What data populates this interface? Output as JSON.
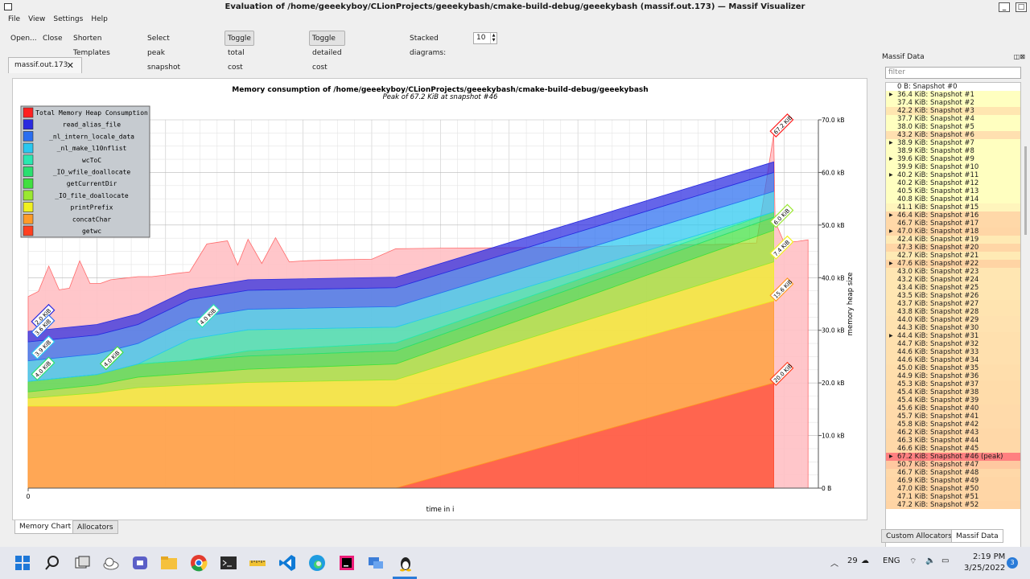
{
  "window": {
    "title": "Evaluation of /home/geeekyboy/CLionProjects/geeekybash/cmake-build-debug/geeekybash (massif.out.173) — Massif Visualizer",
    "minimize": "_",
    "close": "□"
  },
  "menu": [
    "File",
    "View",
    "Settings",
    "Help"
  ],
  "toolbar": {
    "open": "Open...",
    "close": "Close",
    "shorten": "Shorten Templates",
    "select_peak": "Select peak snapshot",
    "toggle_total": "Toggle total cost graph",
    "toggle_detailed": "Toggle detailed cost graph",
    "stacked_label": "Stacked diagrams:",
    "stacked_value": "10"
  },
  "doc_tab": {
    "label": "massif.out.173",
    "close": "✕"
  },
  "chart_data": {
    "type": "area",
    "title": "Memory consumption of /home/geeekyboy/CLionProjects/geeekybash/cmake-build-debug/geeekybash",
    "subtitle": "Peak of 67.2 KiB at snapshot #46",
    "xlabel": "time in i",
    "ylabel": "memory heap size",
    "xlim": [
      0,
      11500000000
    ],
    "ylim": [
      0,
      70
    ],
    "x_ticks": [
      "0",
      "1e+09",
      "2e+09",
      "3e+09",
      "4e+09",
      "5e+09",
      "6e+09",
      "7e+09",
      "8e+09",
      "9e+09",
      "1e+10",
      "1.1e+10"
    ],
    "y_ticks": [
      "0 B",
      "10.0 kB",
      "20.0 kB",
      "30.0 kB",
      "40.0 kB",
      "50.0 kB",
      "60.0 kB",
      "70.0 kB"
    ],
    "legend_position": "top-left",
    "series_order": [
      "getwc",
      "concatChar",
      "printPrefix",
      "_IO_file_doallocate",
      "getCurrentDir",
      "_IO_wfile_doallocate",
      "wcToC",
      "_nl_make_l10nflist",
      "_nl_intern_locale_data",
      "read_alias_file"
    ],
    "series": [
      {
        "name": "Total Memory Heap Consumption",
        "color": "#ff2020",
        "x": [
          0,
          0.15,
          0.3,
          0.45,
          0.6,
          0.75,
          0.9,
          1.05,
          1.2,
          1.4,
          1.6,
          1.8,
          2.0,
          2.15,
          2.35,
          2.6,
          2.75,
          2.9,
          3.05,
          3.2,
          3.4,
          3.6,
          3.8,
          4.0,
          4.5,
          5.0,
          5.35,
          6.0,
          7.0,
          8.0,
          9.0,
          10.0,
          10.6,
          10.85,
          10.87,
          11.0,
          11.2,
          11.35
        ],
        "y": [
          36.4,
          37.4,
          42.2,
          37.7,
          38.0,
          43.2,
          38.9,
          38.9,
          39.6,
          39.9,
          40.2,
          40.2,
          40.5,
          40.8,
          41.1,
          46.4,
          46.7,
          47.0,
          42.4,
          47.3,
          42.7,
          47.6,
          43.0,
          43.2,
          43.4,
          43.5,
          45.5,
          45.6,
          45.7,
          45.8,
          46.2,
          46.3,
          46.6,
          67.2,
          50.7,
          46.7,
          46.9,
          47.2
        ]
      },
      {
        "name": "read_alias_file",
        "color": "#2a2ae0"
      },
      {
        "name": "_nl_intern_locale_data",
        "color": "#2a6ef0"
      },
      {
        "name": "_nl_make_l10nflist",
        "color": "#2ac8f0"
      },
      {
        "name": "wcToC",
        "color": "#2ae8b0"
      },
      {
        "name": "_IO_wfile_doallocate",
        "color": "#2ae070"
      },
      {
        "name": "getCurrentDir",
        "color": "#40e040"
      },
      {
        "name": "_IO_file_doallocate",
        "color": "#9ae830"
      },
      {
        "name": "printPrefix",
        "color": "#f0f020"
      },
      {
        "name": "concatChar",
        "color": "#ff9b28"
      },
      {
        "name": "getwc",
        "color": "#ff4020"
      }
    ],
    "stack_x": [
      0,
      1.0,
      1.6,
      2.35,
      3.2,
      5.35,
      10.85
    ],
    "stack_values": {
      "getwc": [
        0,
        0,
        0,
        0,
        0,
        0,
        20.0
      ],
      "concatChar": [
        15.6,
        15.6,
        15.6,
        15.6,
        15.6,
        15.6,
        15.6
      ],
      "printPrefix": [
        1.5,
        2.5,
        3.5,
        4.0,
        4.5,
        5.0,
        7.4
      ],
      "_IO_file_doallocate": [
        1.2,
        1.5,
        2.0,
        2.2,
        2.5,
        3.0,
        6.0
      ],
      "getCurrentDir": [
        2.0,
        2.0,
        2.5,
        2.5,
        2.5,
        2.5,
        2.5
      ],
      "_IO_wfile_doallocate": [
        0,
        0,
        0,
        0,
        1.0,
        1.5,
        1.0
      ],
      "wcToC": [
        0,
        0,
        0,
        4.0,
        4.0,
        3.0,
        0
      ],
      "_nl_make_l10nflist": [
        3.9,
        3.9,
        3.9,
        3.9,
        3.9,
        3.9,
        3.9
      ],
      "_nl_intern_locale_data": [
        3.6,
        3.6,
        3.6,
        3.6,
        3.6,
        3.6,
        3.6
      ],
      "read_alias_file": [
        2.0,
        2.0,
        2.0,
        2.0,
        2.0,
        2.0,
        2.0
      ]
    },
    "annotations": [
      {
        "text": "67.2 KiB",
        "x": 10.85,
        "y": 67.2,
        "color": "#ff2020"
      },
      {
        "text": "6.0 KiB",
        "x": 10.85,
        "y": 50.0,
        "color": "#9ae830"
      },
      {
        "text": "7.4 KiB",
        "x": 10.85,
        "y": 44.0,
        "color": "#f0f020"
      },
      {
        "text": "15.6 KiB",
        "x": 10.85,
        "y": 36.0,
        "color": "#ff9b28"
      },
      {
        "text": "20.0 KiB",
        "x": 10.85,
        "y": 20.0,
        "color": "#ff4020"
      },
      {
        "text": "2.0 KiB",
        "x": 0.1,
        "y": 31.0,
        "color": "#2a2ae0"
      },
      {
        "text": "3.6 KiB",
        "x": 0.1,
        "y": 29.0,
        "color": "#2a6ef0"
      },
      {
        "text": "3.9 KiB",
        "x": 0.1,
        "y": 25.0,
        "color": "#2ac8f0"
      },
      {
        "text": "4.0 KiB",
        "x": 0.1,
        "y": 21.0,
        "color": "#2ae070"
      },
      {
        "text": "4.0 KiB",
        "x": 1.1,
        "y": 23.0,
        "color": "#40e040"
      },
      {
        "text": "4.0 KiB",
        "x": 2.5,
        "y": 31.0,
        "color": "#2ae8b0"
      }
    ]
  },
  "bottom_tabs": [
    "Memory Chart",
    "Allocators"
  ],
  "massif_panel": {
    "title": "Massif Data",
    "filter_placeholder": "filter",
    "snapshots": [
      {
        "label": "0 B: Snapshot #0",
        "expandable": false,
        "color": "#ffffff"
      },
      {
        "label": "36.4 KiB: Snapshot #1",
        "expandable": true,
        "color": "#ffffc0"
      },
      {
        "label": "37.4 KiB: Snapshot #2",
        "expandable": false,
        "color": "#ffffc0"
      },
      {
        "label": "42.2 KiB: Snapshot #3",
        "expandable": false,
        "color": "#ffe6b0"
      },
      {
        "label": "37.7 KiB: Snapshot #4",
        "expandable": false,
        "color": "#ffffc0"
      },
      {
        "label": "38.0 KiB: Snapshot #5",
        "expandable": false,
        "color": "#ffffc0"
      },
      {
        "label": "43.2 KiB: Snapshot #6",
        "expandable": false,
        "color": "#ffe0b0"
      },
      {
        "label": "38.9 KiB: Snapshot #7",
        "expandable": true,
        "color": "#ffffc0"
      },
      {
        "label": "38.9 KiB: Snapshot #8",
        "expandable": false,
        "color": "#ffffc0"
      },
      {
        "label": "39.6 KiB: Snapshot #9",
        "expandable": true,
        "color": "#ffffc0"
      },
      {
        "label": "39.9 KiB: Snapshot #10",
        "expandable": false,
        "color": "#ffffc0"
      },
      {
        "label": "40.2 KiB: Snapshot #11",
        "expandable": true,
        "color": "#ffffc0"
      },
      {
        "label": "40.2 KiB: Snapshot #12",
        "expandable": false,
        "color": "#ffffc0"
      },
      {
        "label": "40.5 KiB: Snapshot #13",
        "expandable": false,
        "color": "#ffffc0"
      },
      {
        "label": "40.8 KiB: Snapshot #14",
        "expandable": false,
        "color": "#ffffc0"
      },
      {
        "label": "41.1 KiB: Snapshot #15",
        "expandable": false,
        "color": "#fff5bc"
      },
      {
        "label": "46.4 KiB: Snapshot #16",
        "expandable": true,
        "color": "#ffd8a8"
      },
      {
        "label": "46.7 KiB: Snapshot #17",
        "expandable": false,
        "color": "#ffd8a8"
      },
      {
        "label": "47.0 KiB: Snapshot #18",
        "expandable": true,
        "color": "#ffd6a6"
      },
      {
        "label": "42.4 KiB: Snapshot #19",
        "expandable": false,
        "color": "#ffeab4"
      },
      {
        "label": "47.3 KiB: Snapshot #20",
        "expandable": false,
        "color": "#ffd6a6"
      },
      {
        "label": "42.7 KiB: Snapshot #21",
        "expandable": false,
        "color": "#ffeab4"
      },
      {
        "label": "47.6 KiB: Snapshot #22",
        "expandable": true,
        "color": "#ffd4a4"
      },
      {
        "label": "43.0 KiB: Snapshot #23",
        "expandable": false,
        "color": "#ffe6b2"
      },
      {
        "label": "43.2 KiB: Snapshot #24",
        "expandable": false,
        "color": "#ffe6b2"
      },
      {
        "label": "43.4 KiB: Snapshot #25",
        "expandable": false,
        "color": "#ffe6b2"
      },
      {
        "label": "43.5 KiB: Snapshot #26",
        "expandable": false,
        "color": "#ffe6b2"
      },
      {
        "label": "43.7 KiB: Snapshot #27",
        "expandable": false,
        "color": "#ffe4b0"
      },
      {
        "label": "43.8 KiB: Snapshot #28",
        "expandable": false,
        "color": "#ffe4b0"
      },
      {
        "label": "44.0 KiB: Snapshot #29",
        "expandable": false,
        "color": "#ffe2b0"
      },
      {
        "label": "44.3 KiB: Snapshot #30",
        "expandable": false,
        "color": "#ffe2b0"
      },
      {
        "label": "44.4 KiB: Snapshot #31",
        "expandable": true,
        "color": "#ffe0ae"
      },
      {
        "label": "44.7 KiB: Snapshot #32",
        "expandable": false,
        "color": "#ffe0ae"
      },
      {
        "label": "44.6 KiB: Snapshot #33",
        "expandable": false,
        "color": "#ffe0ae"
      },
      {
        "label": "44.6 KiB: Snapshot #34",
        "expandable": false,
        "color": "#ffe0ae"
      },
      {
        "label": "45.0 KiB: Snapshot #35",
        "expandable": false,
        "color": "#ffdeac"
      },
      {
        "label": "44.9 KiB: Snapshot #36",
        "expandable": false,
        "color": "#ffdeac"
      },
      {
        "label": "45.3 KiB: Snapshot #37",
        "expandable": false,
        "color": "#ffdcaa"
      },
      {
        "label": "45.4 KiB: Snapshot #38",
        "expandable": false,
        "color": "#ffdcaa"
      },
      {
        "label": "45.4 KiB: Snapshot #39",
        "expandable": false,
        "color": "#ffdcaa"
      },
      {
        "label": "45.6 KiB: Snapshot #40",
        "expandable": false,
        "color": "#ffdaaa"
      },
      {
        "label": "45.7 KiB: Snapshot #41",
        "expandable": false,
        "color": "#ffdaaa"
      },
      {
        "label": "45.8 KiB: Snapshot #42",
        "expandable": false,
        "color": "#ffdaaa"
      },
      {
        "label": "46.2 KiB: Snapshot #43",
        "expandable": false,
        "color": "#ffd8a8"
      },
      {
        "label": "46.3 KiB: Snapshot #44",
        "expandable": false,
        "color": "#ffd8a8"
      },
      {
        "label": "46.6 KiB: Snapshot #45",
        "expandable": false,
        "color": "#ffd8a8"
      },
      {
        "label": "67.2 KiB: Snapshot #46 (peak)",
        "expandable": true,
        "color": "#ff8080"
      },
      {
        "label": "50.7 KiB: Snapshot #47",
        "expandable": false,
        "color": "#ffc8a0"
      },
      {
        "label": "46.7 KiB: Snapshot #48",
        "expandable": false,
        "color": "#ffd8a8"
      },
      {
        "label": "46.9 KiB: Snapshot #49",
        "expandable": false,
        "color": "#ffd6a6"
      },
      {
        "label": "47.0 KiB: Snapshot #50",
        "expandable": false,
        "color": "#ffd6a6"
      },
      {
        "label": "47.1 KiB: Snapshot #51",
        "expandable": false,
        "color": "#ffd6a6"
      },
      {
        "label": "47.2 KiB: Snapshot #52",
        "expandable": false,
        "color": "#ffd4a4"
      }
    ],
    "tabs": [
      "Custom Allocators",
      "Massif Data"
    ]
  },
  "taskbar": {
    "icons": [
      "windows-start-icon",
      "search-icon",
      "task-view-icon",
      "onedrive-icon",
      "teams-icon",
      "file-explorer-icon",
      "chrome-icon",
      "terminal-icon",
      "ruler-icon",
      "vscode-icon",
      "edge-icon",
      "intellij-icon",
      "remote-desktop-icon",
      "linux-tux-icon"
    ],
    "temperature": "29",
    "language": "ENG",
    "time": "2:19 PM",
    "date": "3/25/2022",
    "notification_count": "3"
  }
}
